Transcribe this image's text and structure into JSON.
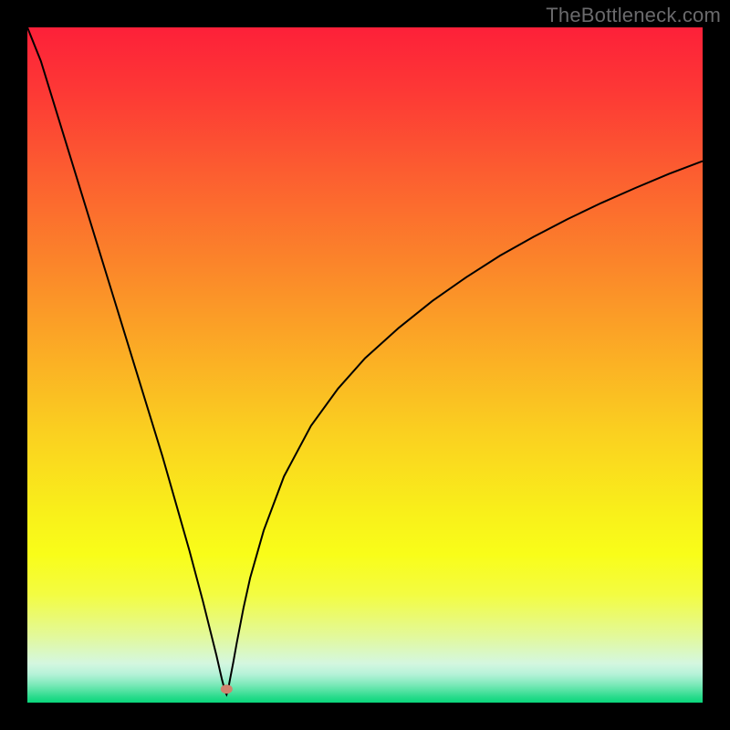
{
  "watermark": "TheBottleneck.com",
  "chart_data": {
    "type": "line",
    "title": "",
    "xlabel": "",
    "ylabel": "",
    "xlim": [
      0,
      100
    ],
    "ylim": [
      0,
      100
    ],
    "grid": false,
    "legend": false,
    "background_gradient": {
      "stops": [
        {
          "offset": 0.0,
          "color": "#fd2039"
        },
        {
          "offset": 0.1,
          "color": "#fd3a35"
        },
        {
          "offset": 0.22,
          "color": "#fc5f30"
        },
        {
          "offset": 0.35,
          "color": "#fb852a"
        },
        {
          "offset": 0.48,
          "color": "#fbac25"
        },
        {
          "offset": 0.6,
          "color": "#fad020"
        },
        {
          "offset": 0.72,
          "color": "#f9f01a"
        },
        {
          "offset": 0.78,
          "color": "#f9fd19"
        },
        {
          "offset": 0.84,
          "color": "#f3fc42"
        },
        {
          "offset": 0.9,
          "color": "#e3f998"
        },
        {
          "offset": 0.942,
          "color": "#d4f7e0"
        },
        {
          "offset": 0.958,
          "color": "#b5f2d8"
        },
        {
          "offset": 0.972,
          "color": "#81eabc"
        },
        {
          "offset": 0.984,
          "color": "#4de19f"
        },
        {
          "offset": 0.992,
          "color": "#27db8b"
        },
        {
          "offset": 1.0,
          "color": "#0ad67b"
        }
      ]
    },
    "marker": {
      "x": 29.5,
      "y": 2.0,
      "color": "#d0836e"
    },
    "series": [
      {
        "name": "curve",
        "color": "#000000",
        "width": 2.0,
        "x": [
          0.0,
          2,
          4,
          6,
          8,
          10,
          12,
          14,
          16,
          18,
          20,
          22,
          24,
          26,
          27,
          28,
          28.8,
          29.3,
          29.5,
          29.7,
          30.0,
          30.5,
          31,
          32,
          33,
          35,
          38,
          42,
          46,
          50,
          55,
          60,
          65,
          70,
          75,
          80,
          85,
          90,
          95,
          100
        ],
        "y": [
          100,
          95.0,
          88.5,
          82.0,
          75.5,
          69.0,
          62.5,
          56.0,
          49.5,
          43.0,
          36.5,
          29.5,
          22.5,
          15.0,
          11.0,
          7.0,
          3.5,
          1.6,
          1.2,
          1.8,
          3.4,
          6.0,
          8.8,
          14.0,
          18.5,
          25.5,
          33.5,
          41.0,
          46.5,
          51.0,
          55.5,
          59.5,
          63.0,
          66.2,
          69.0,
          71.6,
          74.0,
          76.2,
          78.3,
          80.2
        ]
      }
    ]
  }
}
